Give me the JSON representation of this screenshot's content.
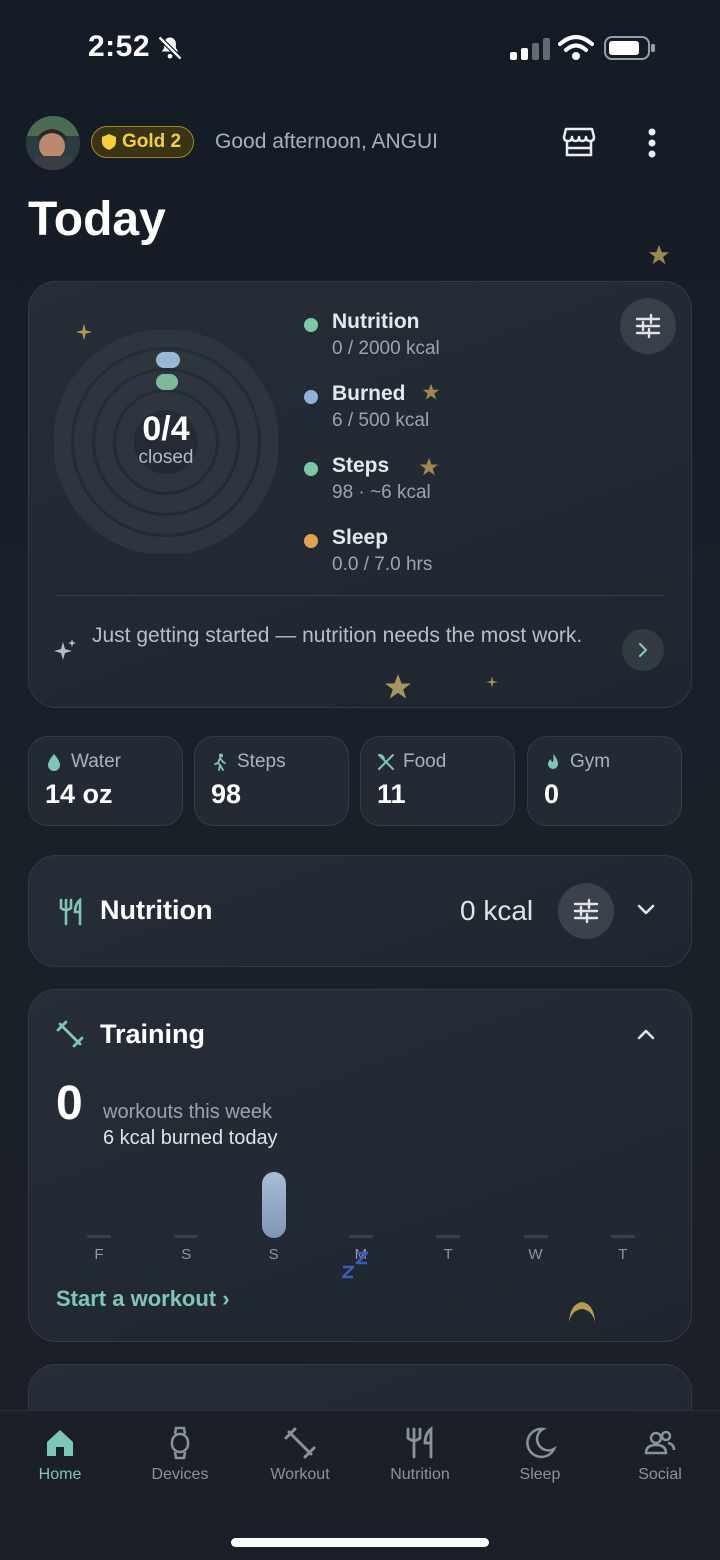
{
  "status_bar": {
    "time": "2:52"
  },
  "header": {
    "badge": "Gold 2",
    "greeting": "Good afternoon, ANGUI",
    "title": "Today"
  },
  "summary": {
    "count": "0/4",
    "count_label": "closed",
    "metrics": [
      {
        "name": "Nutrition",
        "value": "0 / 2000 kcal",
        "color": "#7dc7a6"
      },
      {
        "name": "Burned",
        "value": "6 / 500 kcal",
        "color": "#8fb2d9"
      },
      {
        "name": "Steps",
        "value": "98 · ~6 kcal",
        "color": "#7dc7a6"
      },
      {
        "name": "Sleep",
        "value": "0.0 / 7.0 hrs",
        "color": "#e0a352"
      }
    ],
    "insight": "Just getting started — nutrition needs the most work."
  },
  "tiles": [
    {
      "label": "Water",
      "value": "14 oz",
      "icon": "water-drop-icon"
    },
    {
      "label": "Steps",
      "value": "98",
      "icon": "walking-icon"
    },
    {
      "label": "Food",
      "value": "11",
      "icon": "utensils-icon"
    },
    {
      "label": "Gym",
      "value": "0",
      "icon": "flame-icon"
    }
  ],
  "nutrition": {
    "title": "Nutrition",
    "kcal": "0 kcal"
  },
  "training": {
    "title": "Training",
    "count": "0",
    "sub1": "workouts this week",
    "sub2": "6 kcal burned today",
    "days": [
      "F",
      "S",
      "S",
      "M",
      "T",
      "W",
      "T"
    ],
    "active_day_index": 2,
    "start_link": "Start a workout"
  },
  "tabs": [
    {
      "label": "Home",
      "icon": "home-icon",
      "active": true
    },
    {
      "label": "Devices",
      "icon": "watch-icon",
      "active": false
    },
    {
      "label": "Workout",
      "icon": "dumbbell-icon",
      "active": false
    },
    {
      "label": "Nutrition",
      "icon": "utensils-icon",
      "active": false
    },
    {
      "label": "Sleep",
      "icon": "moon-icon",
      "active": false
    },
    {
      "label": "Social",
      "icon": "people-icon",
      "active": false
    }
  ],
  "colors": {
    "accent": "#7fc7b5",
    "gold": "#f4d03f"
  }
}
